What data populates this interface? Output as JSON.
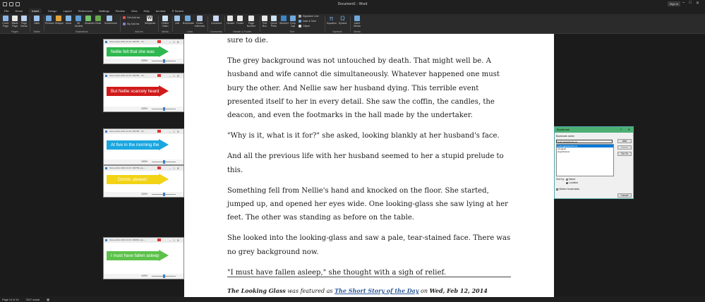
{
  "app": {
    "title": "Document1 - Word",
    "signin": "Sign in"
  },
  "tabs": [
    "File",
    "Home",
    "Insert",
    "Design",
    "Layout",
    "References",
    "Mailings",
    "Review",
    "View",
    "Help",
    "Acrobat",
    "Search"
  ],
  "ribbon": {
    "pages": {
      "items": [
        "Cover Page",
        "Blank Page",
        "Page Break"
      ],
      "label": "Pages"
    },
    "tables": {
      "items": [
        "Table"
      ],
      "label": "Tables"
    },
    "illustrations": {
      "items": [
        "Pictures",
        "Shapes",
        "Icons",
        "3D Models",
        "SmartArt",
        "Chart",
        "Screenshot"
      ],
      "label": "Illustrations"
    },
    "addins": {
      "items": [
        "Get Add-ins",
        "My Add-ins",
        "Wikipedia"
      ],
      "label": "Add-ins"
    },
    "media": {
      "items": [
        "Online Video"
      ],
      "label": "Media"
    },
    "links": {
      "items": [
        "Link",
        "Bookmark",
        "Cross-reference"
      ],
      "label": "Links"
    },
    "comments": {
      "items": [
        "Comment"
      ],
      "label": "Comments"
    },
    "headerfooter": {
      "items": [
        "Header",
        "Footer",
        "Page Number"
      ],
      "label": "Header & Footer"
    },
    "text": {
      "items": [
        "Text Box",
        "Quick Parts",
        "WordArt",
        "Drop Cap"
      ],
      "side": [
        "Signature Line",
        "Date & Time",
        "Object"
      ],
      "label": "Text"
    },
    "symbols": {
      "items": [
        "Equation",
        "Symbol"
      ],
      "label": "Symbols"
    },
    "media2": {
      "items": [
        "Insert Media"
      ],
      "label": "Media"
    }
  },
  "document": {
    "paragraphs": [
      "sure to die.",
      "The grey background was not untouched by death. That might well be. A husband and wife cannot die simultaneously. Whatever happened one must bury the other. And Nellie saw her husband dying. This terrible event presented itself to her in every detail. She saw the coffin, the candles, the deacon, and even the footmarks in the hall made by the undertaker.",
      "\"Why is it, what is it for?\" she asked, looking blankly at her husband's face.",
      "And all the previous life with her husband seemed to her a stupid prelude to this.",
      "Something fell from Nellie's hand and knocked on the floor. She started, jumped up, and opened her eyes wide. One looking-glass she saw lying at her feet. The other was standing as before on the table.",
      "She looked into the looking-glass and saw a pale, tear-stained face. There was no grey background now.",
      "\"I must have fallen asleep,\" she thought with a sigh of relief."
    ],
    "footer": {
      "title": "The Looking Glass",
      "mid": " was featured as ",
      "link": "The Short Story of the Day",
      "on": " on ",
      "date": "Wed, Feb 12, 2014"
    }
  },
  "screenshots": [
    {
      "title": "Screenshot 2021-04-15 100755 - Cli...",
      "text": "Nellie felt that she was",
      "color": "#2fb84f",
      "zoom": "100%"
    },
    {
      "title": "Screenshot 2021-04-15 100756 - Cli...",
      "text": "But Nellie scarcely heard",
      "color": "#d11a1a",
      "zoom": "100%"
    },
    {
      "title": "Screenshot 2021-04-15 100758 - Cli...",
      "text": "At five in the morning the",
      "color": "#1aa7e0",
      "zoom": "100%"
    },
    {
      "title": "Screenshot 2021-04-15 100759.png -...",
      "text": "Doctor, please!",
      "color": "#f2d316",
      "zoom": "100%"
    },
    {
      "title": "Screenshot 2021-04-15 100801.png -...",
      "text": "I must have fallen asleep",
      "color": "#5cc24a",
      "zoom": "100%"
    }
  ],
  "bookmark_dialog": {
    "title": "Bookmark",
    "name_label": "Bookmark name:",
    "name_value": "lookingglassbeforeno",
    "list": [
      "lookingglassbeforeno",
      "lookingglassbeforeno",
      "nbsdguill",
      "sleepfirstend"
    ],
    "buttons": [
      "Add",
      "Delete",
      "Go To",
      "Cancel"
    ],
    "sort_label": "Sort by:",
    "sort_options": [
      "Name",
      "Location"
    ],
    "hidden_label": "Hidden bookmarks"
  },
  "status": {
    "page": "Page 14 of 14",
    "words": "3347 words"
  }
}
